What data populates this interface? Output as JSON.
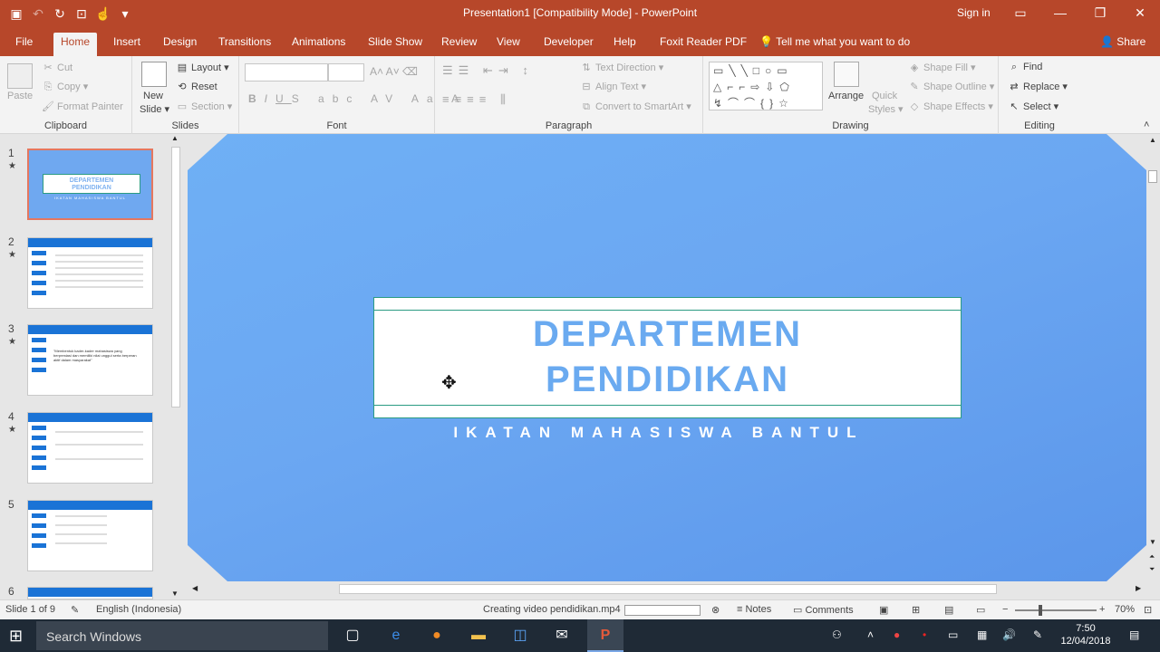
{
  "window": {
    "title": "Presentation1 [Compatibility Mode]  -  PowerPoint",
    "signin": "Sign in"
  },
  "tabs": [
    "File",
    "Home",
    "Insert",
    "Design",
    "Transitions",
    "Animations",
    "Slide Show",
    "Review",
    "View",
    "Developer",
    "Help",
    "Foxit Reader PDF"
  ],
  "tell_me": "Tell me what you want to do",
  "share": "Share",
  "ribbon": {
    "clipboard": {
      "label": "Clipboard",
      "paste": "Paste",
      "cut": "Cut",
      "copy": "Copy",
      "format_painter": "Format Painter"
    },
    "slides": {
      "label": "Slides",
      "new_slide_1": "New",
      "new_slide_2": "Slide",
      "layout": "Layout",
      "reset": "Reset",
      "section": "Section"
    },
    "font": {
      "label": "Font"
    },
    "paragraph": {
      "label": "Paragraph",
      "text_direction": "Text Direction",
      "align_text": "Align Text",
      "smartart": "Convert to SmartArt"
    },
    "drawing": {
      "label": "Drawing",
      "arrange": "Arrange",
      "quick_styles_1": "Quick",
      "quick_styles_2": "Styles",
      "shape_fill": "Shape Fill",
      "shape_outline": "Shape Outline",
      "shape_effects": "Shape Effects"
    },
    "editing": {
      "label": "Editing",
      "find": "Find",
      "replace": "Replace",
      "select": "Select"
    }
  },
  "thumbnails": [
    {
      "num": "1"
    },
    {
      "num": "2"
    },
    {
      "num": "3"
    },
    {
      "num": "4"
    },
    {
      "num": "5"
    },
    {
      "num": "6"
    }
  ],
  "thumb1": {
    "title1": "DEPARTEMEN",
    "title2": "PENDIDIKAN",
    "subtitle": "IKATAN MAHASISWA BANTUL"
  },
  "thumb3": {
    "text": "\"Membentuk kader-kader mahasiswa yang berprestasi dan memiliki nilai unggul serta berperan aktif dalam masyarakat\""
  },
  "slide": {
    "title_line1": "DEPARTEMEN",
    "title_line2": "PENDIDIKAN",
    "subtitle": "IKATAN MAHASISWA BANTUL"
  },
  "status": {
    "slide_of": "Slide 1 of 9",
    "language": "English (Indonesia)",
    "task": "Creating video pendidikan.mp4",
    "notes": "Notes",
    "comments": "Comments",
    "zoom": "70%"
  },
  "taskbar": {
    "search": "Search Windows",
    "time": "7:50",
    "date": "12/04/2018"
  },
  "colors": {
    "accent": "#b7472a",
    "slide_bg": "#6ba7f2",
    "title_text": "#6aaaf0",
    "border": "#2b9b82"
  }
}
